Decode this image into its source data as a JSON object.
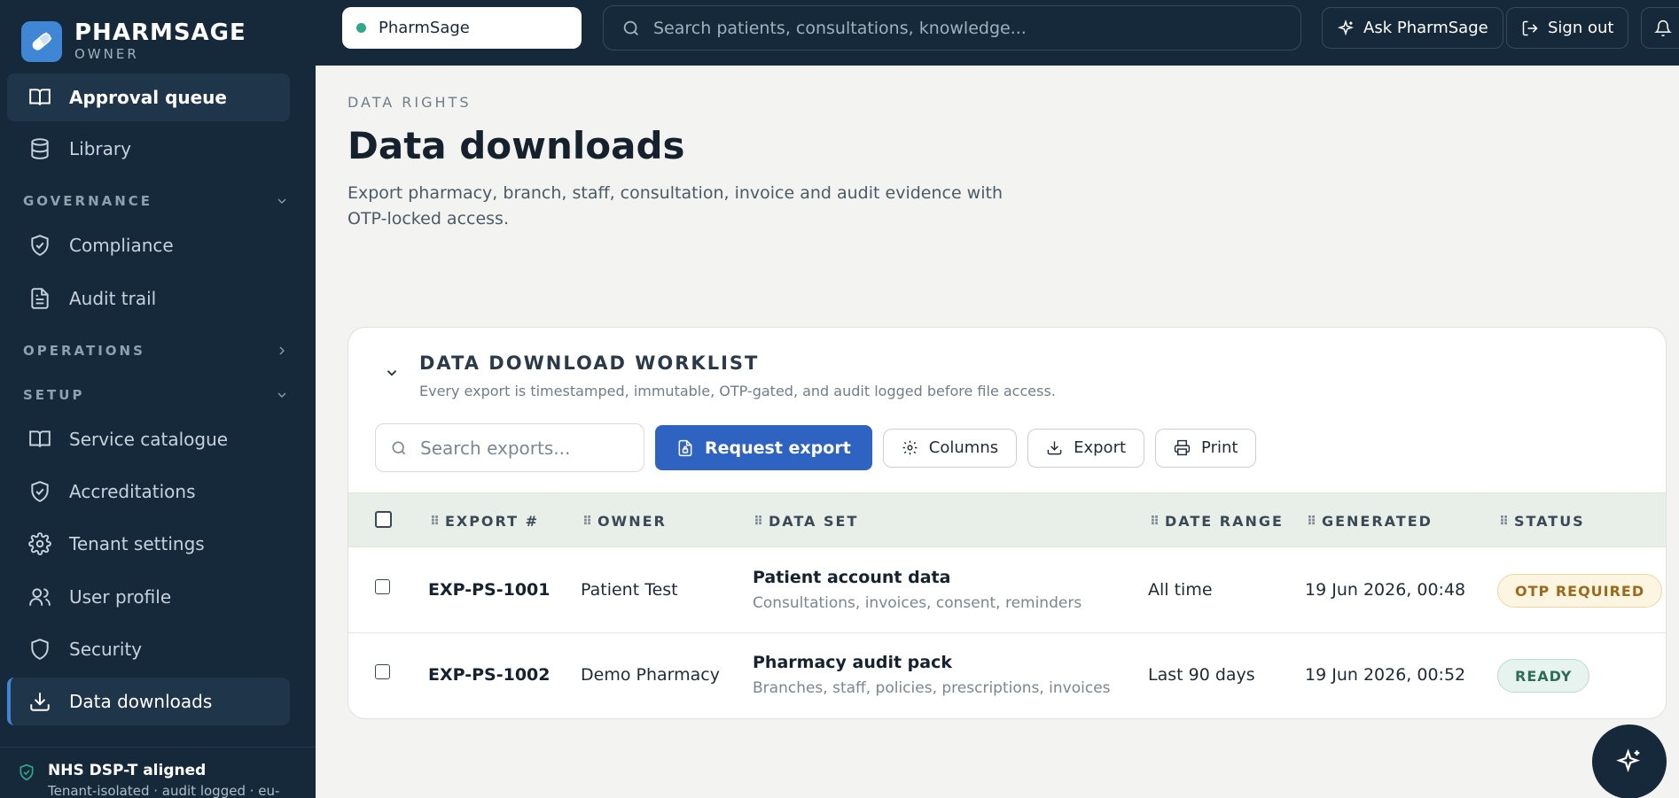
{
  "brand": {
    "name": "PHARMSAGE",
    "role": "OWNER"
  },
  "sidebar": {
    "top_items": [
      {
        "label": "Approval queue",
        "icon": "book-open-icon"
      },
      {
        "label": "Library",
        "icon": "database-icon"
      }
    ],
    "sections": {
      "governance": "GOVERNANCE",
      "operations": "OPERATIONS",
      "setup": "SETUP"
    },
    "governance_items": [
      {
        "label": "Compliance",
        "icon": "shield-check-icon"
      },
      {
        "label": "Audit trail",
        "icon": "file-text-icon"
      }
    ],
    "setup_items": [
      {
        "label": "Service catalogue",
        "icon": "book-open-icon"
      },
      {
        "label": "Accreditations",
        "icon": "shield-check-icon"
      },
      {
        "label": "Tenant settings",
        "icon": "gear-icon"
      },
      {
        "label": "User profile",
        "icon": "users-icon"
      },
      {
        "label": "Security",
        "icon": "shield-icon"
      },
      {
        "label": "Data downloads",
        "icon": "download-icon"
      }
    ],
    "footer": {
      "title": "NHS DSP-T aligned",
      "subtitle": "Tenant-isolated · audit logged · eu-"
    }
  },
  "topbar": {
    "tenant": "PharmSage",
    "search_placeholder": "Search patients, consultations, knowledge...",
    "ask": "Ask PharmSage",
    "signout": "Sign out"
  },
  "page": {
    "eyebrow": "DATA RIGHTS",
    "title": "Data downloads",
    "subtitle": "Export pharmacy, branch, staff, consultation, invoice and audit evidence with OTP-locked access."
  },
  "worklist": {
    "title": "DATA DOWNLOAD WORKLIST",
    "subtitle": "Every export is timestamped, immutable, OTP-gated, and audit logged before file access.",
    "search_placeholder": "Search exports...",
    "request_label": "Request export",
    "columns_label": "Columns",
    "export_label": "Export",
    "print_label": "Print",
    "headers": [
      "EXPORT #",
      "OWNER",
      "DATA SET",
      "DATE RANGE",
      "GENERATED",
      "STATUS"
    ],
    "rows": [
      {
        "id": "EXP-PS-1001",
        "owner": "Patient Test",
        "dataset": "Patient account data",
        "dataset_detail": "Consultations, invoices, consent, reminders",
        "range": "All time",
        "generated": "19 Jun 2026, 00:48",
        "status": "OTP REQUIRED"
      },
      {
        "id": "EXP-PS-1002",
        "owner": "Demo Pharmacy",
        "dataset": "Pharmacy audit pack",
        "dataset_detail": "Branches, staff, policies, prescriptions, invoices",
        "range": "Last 90 days",
        "generated": "19 Jun 2026, 00:52",
        "status": "READY"
      }
    ]
  },
  "colors": {
    "sidebar": "#16293a",
    "accent": "#2f63c2",
    "otp": "#9b6a1b",
    "ready": "#2f6d59"
  }
}
